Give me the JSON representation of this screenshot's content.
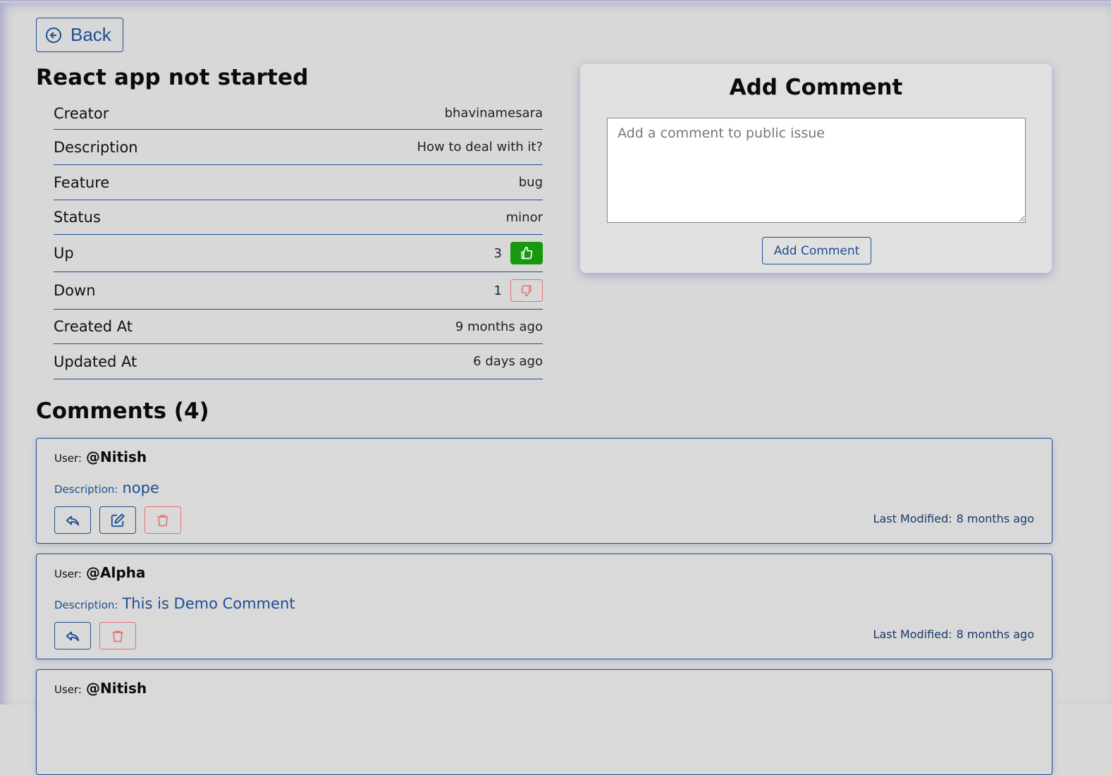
{
  "back_label": "Back",
  "issue": {
    "title": "React app not started",
    "props": [
      {
        "label": "Creator",
        "value": "bhavinamesara"
      },
      {
        "label": "Description",
        "value": "How to deal with it?"
      },
      {
        "label": "Feature",
        "value": "bug"
      },
      {
        "label": "Status",
        "value": "minor"
      },
      {
        "label": "Up",
        "value": "3"
      },
      {
        "label": "Down",
        "value": "1"
      },
      {
        "label": "Created At",
        "value": "9 months ago"
      },
      {
        "label": "Updated At",
        "value": "6 days ago"
      }
    ]
  },
  "add_comment": {
    "title": "Add Comment",
    "placeholder": "Add a comment to public issue",
    "button_label": "Add Comment"
  },
  "comments_heading": "Comments (4)",
  "comment_labels": {
    "user": "User:",
    "description": "Description:",
    "last_modified": "Last Modified:"
  },
  "comments": [
    {
      "user": "@Nitish",
      "description": "nope",
      "last_modified": "8 months ago"
    },
    {
      "user": "@Alpha",
      "description": "This is Demo Comment",
      "last_modified": "8 months ago"
    },
    {
      "user": "@Nitish"
    }
  ],
  "colors": {
    "accent": "#1d4f91",
    "upvote": "#16990f",
    "danger": "#e57373",
    "background": "#d8d8d8"
  }
}
